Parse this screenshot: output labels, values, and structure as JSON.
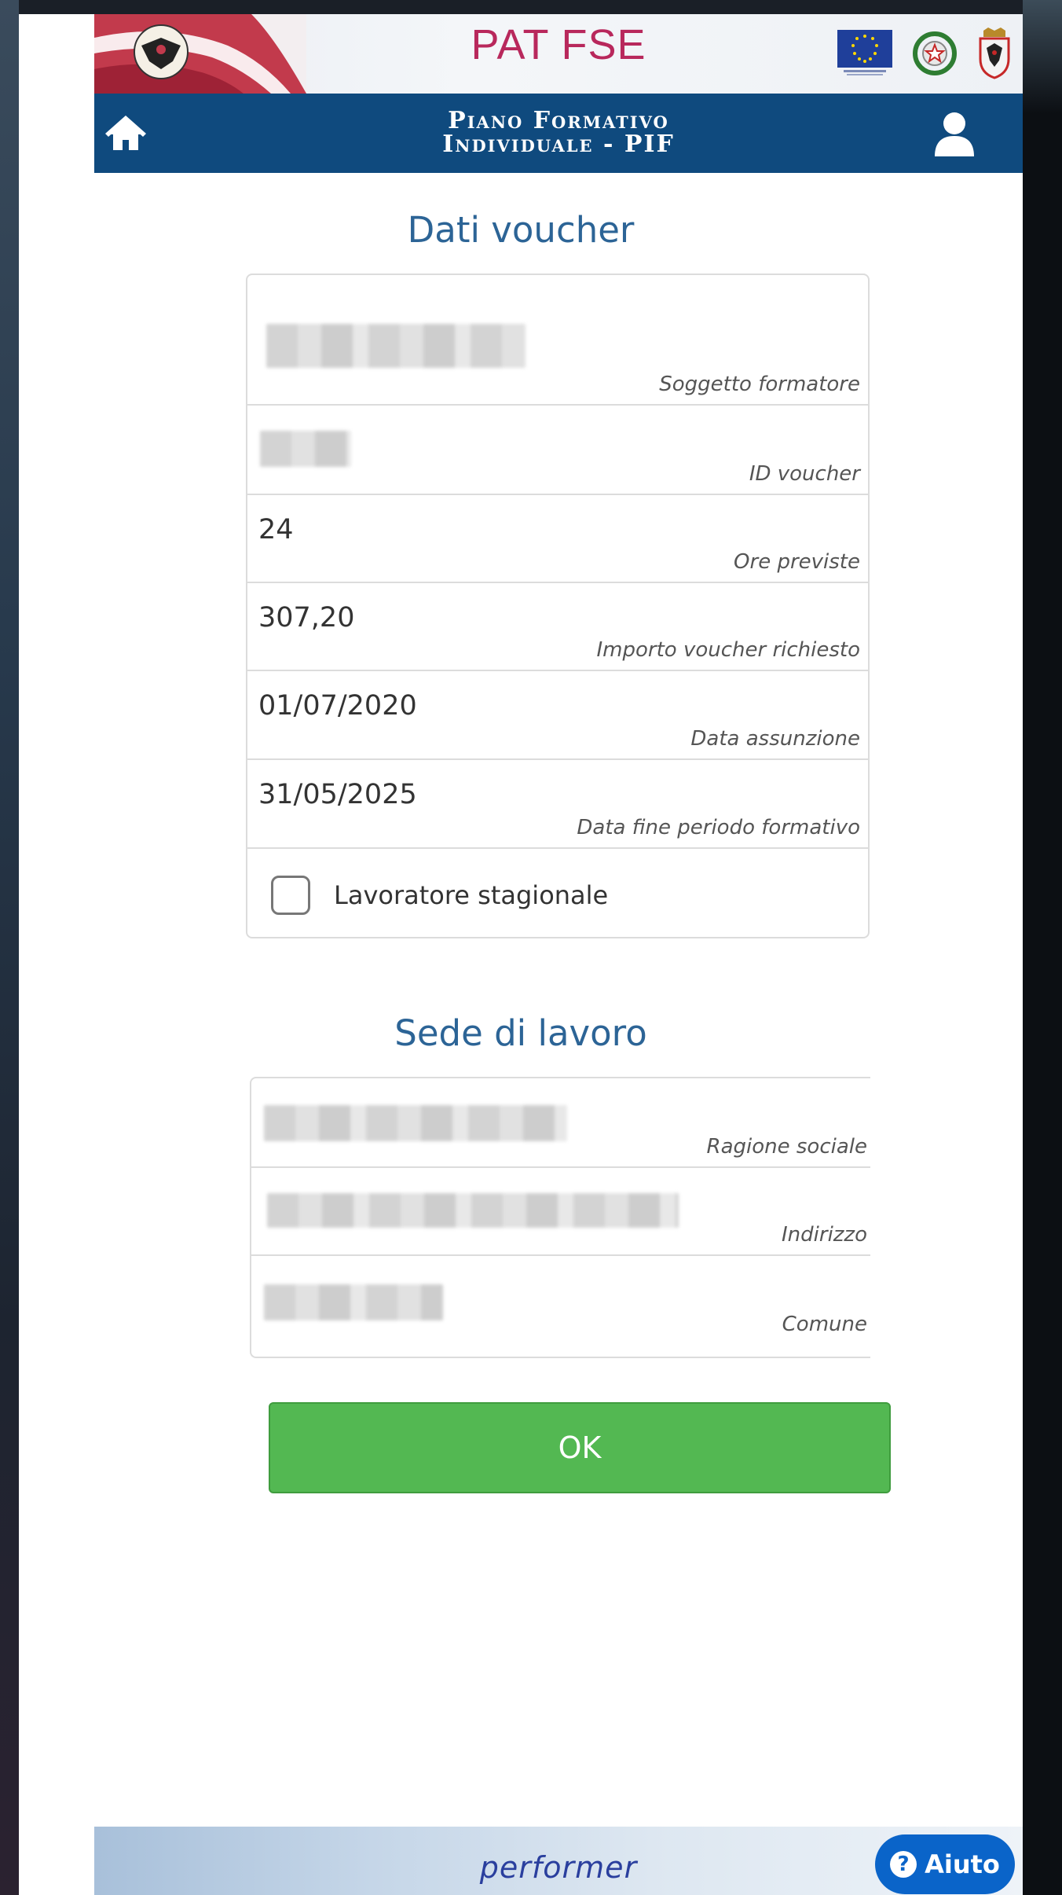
{
  "header": {
    "app_title": "PAT FSE",
    "page_title_line1": "Piano Formativo",
    "page_title_line2": "Individuale - PIF"
  },
  "voucher_section": {
    "title": "Dati voucher",
    "fields": [
      {
        "label": "Soggetto formatore",
        "value": ""
      },
      {
        "label": "ID voucher",
        "value": ""
      },
      {
        "label": "Ore previste",
        "value": "24"
      },
      {
        "label": "Importo voucher richiesto",
        "value": "307,20"
      },
      {
        "label": "Data assunzione",
        "value": "01/07/2020"
      },
      {
        "label": "Data fine periodo formativo",
        "value": "31/05/2025"
      }
    ],
    "checkbox": {
      "label": "Lavoratore stagionale",
      "checked": false
    }
  },
  "workplace_section": {
    "title": "Sede di lavoro",
    "fields": [
      {
        "label": "Ragione sociale",
        "value": ""
      },
      {
        "label": "Indirizzo",
        "value": ""
      },
      {
        "label": "Comune",
        "value": ""
      }
    ]
  },
  "ok_button": {
    "label": "OK"
  },
  "footer": {
    "brand": "performer",
    "help_label": "Aiuto"
  },
  "colors": {
    "navbar": "#0f4a7e",
    "app_title": "#b8285c",
    "section_title": "#2c6496",
    "ok_button": "#53b852",
    "help_button": "#0a64c9"
  }
}
